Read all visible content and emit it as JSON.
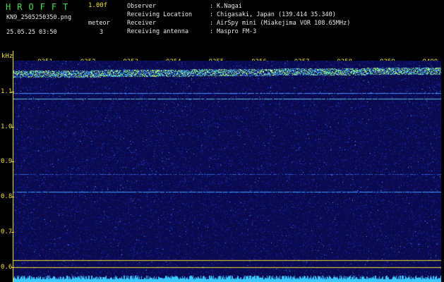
{
  "header": {
    "app_title": "HROFFT",
    "version": "1.00f",
    "filename": "KN9_2505250350.png",
    "mode_label": "meteor",
    "mode_value": "3",
    "datetime": "25.05.25 03:50",
    "info": [
      {
        "key": "Observer",
        "value": "K.Nagai"
      },
      {
        "key": "Receiving Location",
        "value": "Chigasaki, Japan (139.414 35.340)"
      },
      {
        "key": "Receiver",
        "value": "AirSpy mini (Miakejima VOR 108.65MHz)"
      },
      {
        "key": "Receiving antenna",
        "value": "Maspro FM-3"
      }
    ]
  },
  "axis": {
    "unit": "kHz",
    "time_labels": [
      "0351",
      "0352",
      "0353",
      "0354",
      "0355",
      "0356",
      "0357",
      "0358",
      "0359",
      "0400"
    ],
    "freq_labels": [
      "1.1",
      "1.0",
      "0.9",
      "0.8",
      "0.7",
      "0.6"
    ]
  },
  "colors": {
    "label": "#f0e020",
    "info_text": "#e8e8e8",
    "title": "#40e040",
    "background": "#0a0a50",
    "noise": "#2030c0",
    "carrier": "#80ffc0"
  }
}
